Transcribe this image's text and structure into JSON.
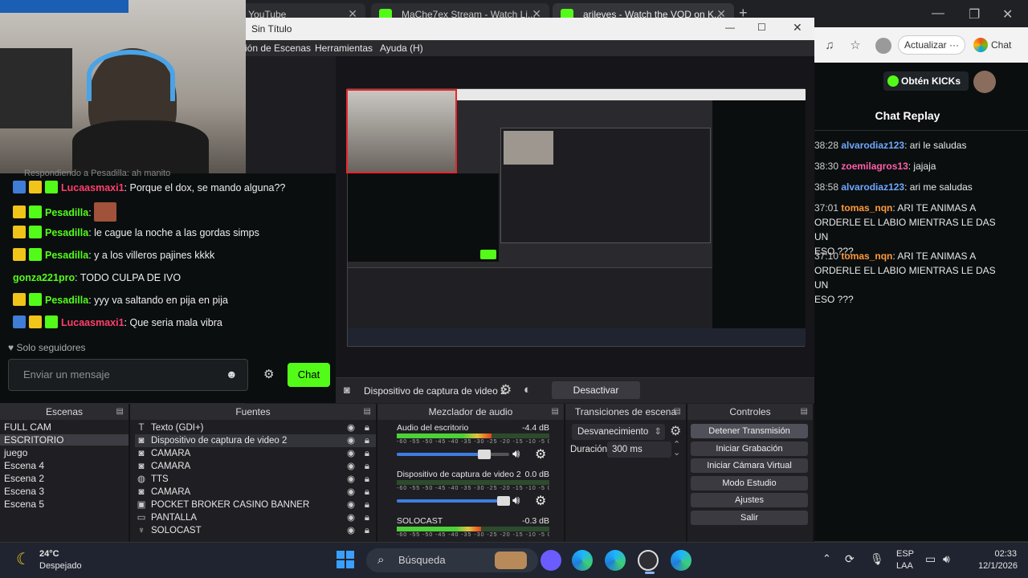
{
  "browser": {
    "tabs": [
      {
        "label": "(138) YouTube"
      },
      {
        "label": "MaChe7ex Stream - Watch Li..."
      },
      {
        "label": "arileves - Watch the VOD on K..."
      }
    ],
    "new_tab": "+",
    "refresh_label": "Actualizar",
    "refresh_more": "···",
    "chat_label": "Chat"
  },
  "kick": {
    "get_kicks_label": "Obtén KICKs",
    "chat_replay_title": "Chat Replay",
    "brand_color": "#53fc18",
    "messages": [
      {
        "time": "38:28",
        "user": "alvarodiaz123",
        "user_color": "#6fa8ff",
        "text": "ari le saludas"
      },
      {
        "time": "38:30",
        "user": "zoemilagros13",
        "user_color": "#ff5fa8",
        "text": "jajaja"
      },
      {
        "time": "38:58",
        "user": "alvarodiaz123",
        "user_color": "#6fa8ff",
        "text": "ari me saludas"
      },
      {
        "time": "37:01",
        "user": "tomas_nqn",
        "user_color": "#ff9a3c",
        "text": "ARI TE ANIMAS A",
        "line2": "ORDERLE EL LABIO MIENTRAS LE DAS UN",
        "line3": "ESO ???"
      },
      {
        "time": "37:10",
        "user": "tomas_nqn",
        "user_color": "#ff9a3c",
        "text": "ARI TE ANIMAS A",
        "line2": "ORDERLE EL LABIO MIENTRAS LE DAS UN",
        "line3": "ESO ???"
      }
    ]
  },
  "obs": {
    "window_title": "Sin Título",
    "menu": [
      "ión de Escenas",
      "Herramientas",
      "Ayuda (H)"
    ],
    "source_bar": {
      "source_name": "Dispositivo de captura de video 2",
      "deactivate_label": "Desactivar"
    },
    "docks": {
      "scenes": {
        "title": "Escenas",
        "items": [
          "FULL CAM",
          "ESCRITORIO",
          "juego",
          "Escena 4",
          "Escena 2",
          "Escena 3",
          "Escena 5"
        ],
        "selected": "ESCRITORIO"
      },
      "sources": {
        "title": "Fuentes",
        "items": [
          {
            "icon": "text-icon",
            "glyph": "T",
            "label": "Texto (GDI+)"
          },
          {
            "icon": "camera-icon",
            "glyph": "◙",
            "label": "Dispositivo de captura de video 2"
          },
          {
            "icon": "camera-icon",
            "glyph": "◙",
            "label": "CAMARA"
          },
          {
            "icon": "camera-icon",
            "glyph": "◙",
            "label": "CAMARA"
          },
          {
            "icon": "globe-icon",
            "glyph": "◍",
            "label": "TTS"
          },
          {
            "icon": "camera-icon",
            "glyph": "◙",
            "label": "CAMARA"
          },
          {
            "icon": "image-icon",
            "glyph": "▣",
            "label": "POCKET BROKER CASINO BANNER"
          },
          {
            "icon": "display-icon",
            "glyph": "▭",
            "label": "PANTALLA"
          },
          {
            "icon": "mic-icon",
            "glyph": "♆",
            "label": "SOLOCAST"
          }
        ]
      },
      "mixer": {
        "title": "Mezclador de audio",
        "channels": [
          {
            "name": "Audio del escritorio",
            "db": "-4.4 dB",
            "level": 0.62,
            "volume": 0.78
          },
          {
            "name": "Dispositivo de captura de video 2",
            "db": "0.0 dB",
            "level": 0.0,
            "volume": 0.95
          },
          {
            "name": "SOLOCAST",
            "db": "-0.3 dB",
            "level": 0.55,
            "volume": 0.9
          }
        ],
        "scale": "-60 -55 -50 -45 -40 -35 -30 -25 -20 -15 -10 -5 0"
      },
      "transitions": {
        "title": "Transiciones de escena",
        "type": "Desvanecimiento",
        "duration_label": "Duración",
        "duration_value": "300 ms"
      },
      "controls": {
        "title": "Controles",
        "buttons": [
          "Detener Transmisión",
          "Iniciar Grabación",
          "Iniciar Cámara Virtual",
          "Modo Estudio",
          "Ajustes",
          "Salir"
        ]
      }
    }
  },
  "left_chat": {
    "top_partial": "Respondiendo a Pesadilla: ah manito",
    "messages": [
      {
        "user": "Lucaasmaxi1",
        "user_color": "#ff3f6c",
        "text": "Porque el dox, se mando alguna??",
        "badges": [
          "#3f7dd6",
          "#f0c419",
          "#53fc18"
        ]
      },
      {
        "user": "Pesadilla",
        "user_color": "#53fc18",
        "text": "",
        "badges": [
          "#f0c419",
          "#53fc18"
        ],
        "emote": true
      },
      {
        "user": "Pesadilla",
        "user_color": "#53fc18",
        "text": "le cague la noche a las gordas simps",
        "badges": [
          "#f0c419",
          "#53fc18"
        ]
      },
      {
        "user": "Pesadilla",
        "user_color": "#53fc18",
        "text": "y a los villeros pajines kkkk",
        "badges": [
          "#f0c419",
          "#53fc18"
        ]
      },
      {
        "user": "gonza221pro",
        "user_color": "#53fc18",
        "text": "TODO CULPA DE IVO",
        "badges": []
      },
      {
        "user": "Pesadilla",
        "user_color": "#53fc18",
        "text": "yyy va saltando en pija en pija",
        "badges": [
          "#f0c419",
          "#53fc18"
        ]
      },
      {
        "user": "Lucaasmaxi1",
        "user_color": "#ff3f6c",
        "text": "Que seria mala vibra",
        "badges": [
          "#3f7dd6",
          "#f0c419",
          "#53fc18"
        ]
      }
    ],
    "followers_only": "Solo seguidores",
    "input_placeholder": "Enviar un mensaje",
    "send_label": "Chat"
  },
  "taskbar": {
    "weather_temp": "24°C",
    "weather_desc": "Despejado",
    "search_placeholder": "Búsqueda",
    "language": "ESP",
    "language2": "LAA",
    "time": "02:33",
    "date": "12/1/2026"
  }
}
